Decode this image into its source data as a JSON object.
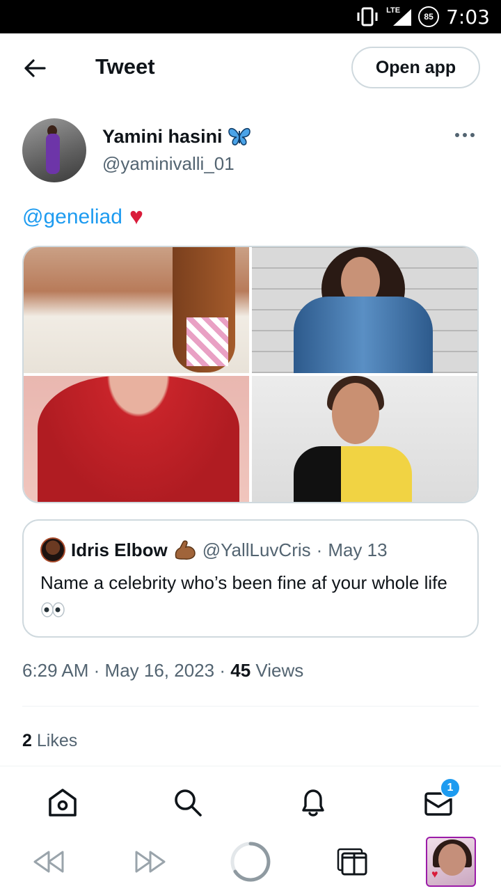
{
  "status_bar": {
    "network": "LTE",
    "battery": "85",
    "time": "7:03"
  },
  "header": {
    "title": "Tweet",
    "open_app_label": "Open app"
  },
  "author": {
    "name": "Yamini hasini",
    "handle": "@yaminivalli_01"
  },
  "tweet": {
    "mention": "@geneliad"
  },
  "quoted_tweet": {
    "name": "Idris Elbow",
    "handle": "@YallLuvCris",
    "separator": "·",
    "date": "May 13",
    "text": "Name a celebrity who’s been fine af your whole life"
  },
  "meta": {
    "time": "6:29 AM",
    "dot1": "·",
    "date": "May 16, 2023",
    "dot2": "·",
    "views_count": "45",
    "views_label": "Views"
  },
  "likes": {
    "count": "2",
    "label": "Likes"
  },
  "bottom_nav": {
    "messages_badge": "1"
  },
  "colors": {
    "link": "#1d9bf0",
    "text": "#0f1419",
    "secondary": "#536471",
    "border": "#cfd9de",
    "heart": "#d91c3a"
  },
  "icons": {
    "back": "back-arrow-icon",
    "more": "more-icon",
    "butterfly": "butterfly-emoji",
    "heart": "heart-emoji",
    "muscle": "flexed-biceps-emoji",
    "eyes": "eyes-emoji",
    "home": "home-icon",
    "search": "search-icon",
    "notifications": "bell-icon",
    "messages": "envelope-icon",
    "rewind": "rewind-icon",
    "forward": "fast-forward-icon",
    "loading": "loading-ring-icon",
    "tabs": "tabs-icon"
  }
}
